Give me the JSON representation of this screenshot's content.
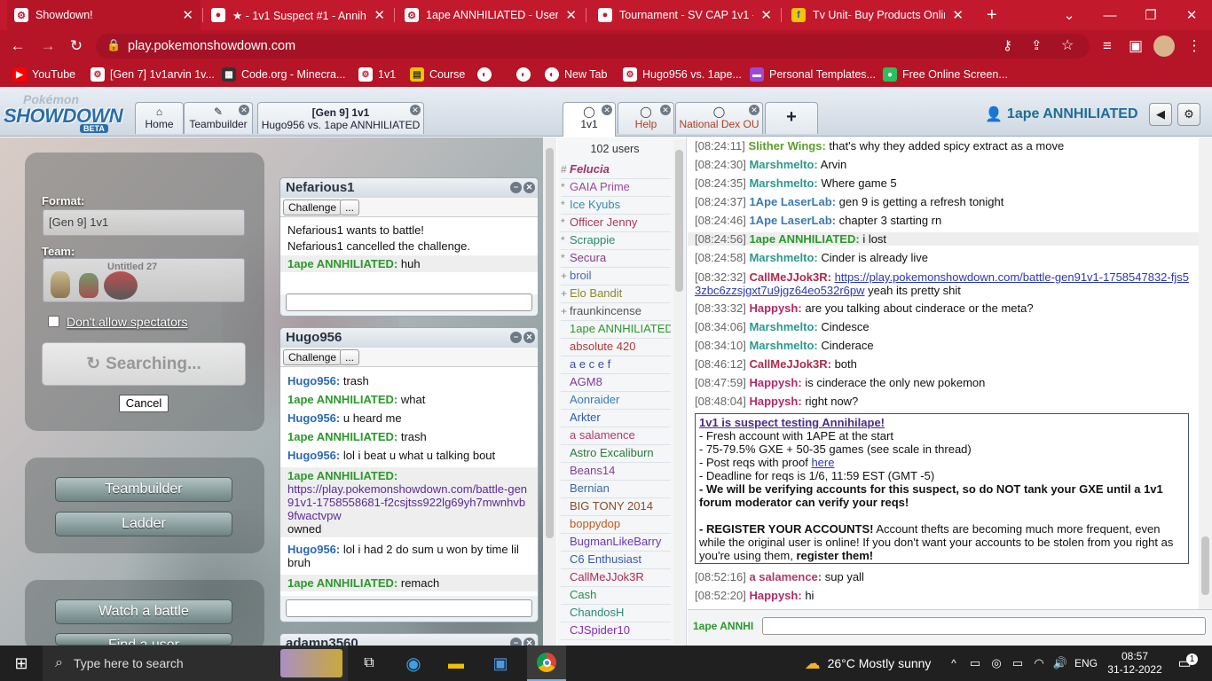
{
  "browser": {
    "tabs": [
      {
        "title": "Showdown!",
        "active": true
      },
      {
        "title": "★ - 1v1 Suspect #1 - Annihila"
      },
      {
        "title": "1ape ANNHILIATED - Users -"
      },
      {
        "title": "Tournament - SV CAP 1v1 - F"
      },
      {
        "title": "Tv Unit- Buy Products Online"
      }
    ],
    "new_tab": "+",
    "url": "play.pokemonshowdown.com",
    "bookmarks": [
      "YouTube",
      "[Gen 7] 1v1arvin 1v...",
      "Code.org - Minecra...",
      "1v1",
      "Course",
      "",
      "",
      "New Tab",
      "Hugo956 vs. 1ape...",
      "Personal Templates...",
      "Free Online Screen..."
    ]
  },
  "showdown": {
    "logo_top": "Pokémon",
    "logo_main": "SHOWDOWN",
    "logo_beta": "BETA",
    "tabs": {
      "home": "Home",
      "teambuilder": "Teambuilder",
      "battle_line1": "[Gen 9] 1v1",
      "battle_line2": "Hugo956 vs. 1ape ANNHILIATED",
      "room1": "1v1",
      "help": "Help",
      "ndou": "National Dex OU",
      "add": "+"
    },
    "username": "1ape ANNHILIATED"
  },
  "mainmenu": {
    "format_label": "Format:",
    "format_value": "[Gen 9] 1v1",
    "team_label": "Team:",
    "team_name": "Untitled 27",
    "spectators": "Don't allow spectators",
    "searching": "Searching...",
    "cancel": "Cancel",
    "teambuilder": "Teambuilder",
    "ladder": "Ladder",
    "watch": "Watch a battle",
    "find_user": "Find a user"
  },
  "pm1": {
    "name": "Nefarious1",
    "challenge": "Challenge",
    "more": "...",
    "lines": [
      {
        "text": "Nefarious1 wants to battle!"
      },
      {
        "text": "Nefarious1 cancelled the challenge."
      }
    ],
    "msg_user": "1ape ANNHILIATED:",
    "msg_text": "huh"
  },
  "pm2": {
    "name": "Hugo956",
    "challenge": "Challenge",
    "more": "...",
    "messages": [
      {
        "user": "Hugo956:",
        "text": "trash"
      },
      {
        "user": "1ape ANNHILIATED:",
        "text": "what"
      },
      {
        "user": "Hugo956:",
        "text": "u heard me"
      },
      {
        "user": "1ape ANNHILIATED:",
        "text": "trash"
      },
      {
        "user": "Hugo956:",
        "text": "lol i beat u what u talking bout"
      }
    ],
    "link_user": "1ape ANNHILIATED:",
    "link": "https://play.pokemonshowdown.com/battle-gen91v1-1758558681-f2csjtss922lg69yh7mwnhvb9fwactvpw",
    "link_after": "owned",
    "msg6_user": "Hugo956:",
    "msg6_text": "lol i had 2 do sum u won by time lil bruh",
    "msg7_user": "1ape ANNHILIATED:",
    "msg7_text": "remach"
  },
  "pm3": {
    "name": "adamn3560"
  },
  "userlist": {
    "count": "102 users",
    "users": [
      {
        "rank": "#",
        "name": "Felucia",
        "color": "#a0306a"
      },
      {
        "rank": "*",
        "name": "GAIA Prime",
        "color": "#9a4a9a"
      },
      {
        "rank": "*",
        "name": "Ice Kyubs",
        "color": "#3a8ab0"
      },
      {
        "rank": "*",
        "name": "Officer Jenny",
        "color": "#a83a5a"
      },
      {
        "rank": "*",
        "name": "Scrappie",
        "color": "#2a8a6a"
      },
      {
        "rank": "*",
        "name": "Secura",
        "color": "#8a3a8a"
      },
      {
        "rank": "+",
        "name": "broil",
        "color": "#4a6ab0"
      },
      {
        "rank": "+",
        "name": "Elo Bandit",
        "color": "#8a8a2a"
      },
      {
        "rank": "+",
        "name": "fraunkincense",
        "color": "#555555"
      },
      {
        "rank": "",
        "name": "1ape ANNHILIATED",
        "color": "#2a9a2a"
      },
      {
        "rank": "",
        "name": "absolute 420",
        "color": "#b03a3a"
      },
      {
        "rank": "",
        "name": "a e c e f",
        "color": "#3a4ab0"
      },
      {
        "rank": "",
        "name": "AGM8",
        "color": "#7a3a9a"
      },
      {
        "rank": "",
        "name": "Aonraider",
        "color": "#3a7ab0"
      },
      {
        "rank": "",
        "name": "Arkter",
        "color": "#2a5ab0"
      },
      {
        "rank": "",
        "name": "a salamence",
        "color": "#b03a6a"
      },
      {
        "rank": "",
        "name": "Astro Excaliburn",
        "color": "#2a7a3a"
      },
      {
        "rank": "",
        "name": "Beans14",
        "color": "#8a3aa0"
      },
      {
        "rank": "",
        "name": "Bernian",
        "color": "#3a6aa0"
      },
      {
        "rank": "",
        "name": "BIG TONY 2014",
        "color": "#8a4a2a"
      },
      {
        "rank": "",
        "name": "boppydop",
        "color": "#c05a1a"
      },
      {
        "rank": "",
        "name": "BugmanLikeBarry",
        "color": "#6a3ab0"
      },
      {
        "rank": "",
        "name": "C6 Enthusiast",
        "color": "#3a5ab0"
      },
      {
        "rank": "",
        "name": "CallMeJJok3R",
        "color": "#b02a4a"
      },
      {
        "rank": "",
        "name": "Cash",
        "color": "#2a8a4a"
      },
      {
        "rank": "",
        "name": "ChandosH",
        "color": "#2a8a7a"
      },
      {
        "rank": "",
        "name": "CJSpider10",
        "color": "#8a2ab0"
      }
    ]
  },
  "chat": {
    "lines": [
      {
        "ts": "[08:24:11]",
        "user": "Slither Wings:",
        "color": "#5aa02a",
        "text": "that's why they added spicy extract as a move"
      },
      {
        "ts": "[08:24:30]",
        "user": "Marshmelto:",
        "color": "#2a9a8a",
        "text": "Arvin"
      },
      {
        "ts": "[08:24:35]",
        "user": "Marshmelto:",
        "color": "#2a9a8a",
        "text": "Where game 5"
      },
      {
        "ts": "[08:24:37]",
        "user": "1Ape LaserLab:",
        "color": "#3a7ab0",
        "text": "gen 9 is getting a refresh tonight"
      },
      {
        "ts": "[08:24:46]",
        "user": "1Ape LaserLab:",
        "color": "#3a7ab0",
        "text": "chapter 3 starting rn"
      },
      {
        "ts": "[08:24:56]",
        "user": "1ape ANNHILIATED:",
        "color": "#2a9a2a",
        "text": "i lost"
      },
      {
        "ts": "[08:24:58]",
        "user": "Marshmelto:",
        "color": "#2a9a8a",
        "text": "Cinder is already live"
      }
    ],
    "link_ts": "[08:32:32]",
    "link_user": "CallMeJJok3R:",
    "link_url": "https://play.pokemonshowdown.com/battle-gen91v1-1758547832-fjs53zbc6zzsjgxt7u9jgz64eo532r6pw",
    "link_after": "yeah its pretty shit",
    "lines2": [
      {
        "ts": "[08:33:32]",
        "user": "Happysh:",
        "color": "#b02a6a",
        "text": "are you talking about cinderace or the meta?"
      },
      {
        "ts": "[08:34:06]",
        "user": "Marshmelto:",
        "color": "#2a9a8a",
        "text": "Cindesce"
      },
      {
        "ts": "[08:34:10]",
        "user": "Marshmelto:",
        "color": "#2a9a8a",
        "text": "Cinderace"
      },
      {
        "ts": "[08:46:12]",
        "user": "CallMeJJok3R:",
        "color": "#b02a4a",
        "text": "both"
      },
      {
        "ts": "[08:47:59]",
        "user": "Happysh:",
        "color": "#b02a6a",
        "text": "is cinderace the only new pokemon"
      },
      {
        "ts": "[08:48:04]",
        "user": "Happysh:",
        "color": "#b02a6a",
        "text": "right now?"
      }
    ],
    "announcement": {
      "title": "1v1 is suspect testing Annihilape!",
      "b1": "- Fresh account with 1APE at the start",
      "b2": "- 75-79.5% GXE + 50-35 games (see scale in thread)",
      "b3_pre": "- Post reqs with proof ",
      "b3_link": "here",
      "b4": "- Deadline for reqs is 1/6, 11:59 EST (GMT -5)",
      "b5": "- We will be verifying accounts for this suspect, so do NOT tank your GXE until a 1v1 forum moderator can verify your reqs!",
      "b6_bold": "- REGISTER YOUR ACCOUNTS!",
      "b6_text": " Account thefts are becoming much more frequent, even while the original user is online! If you don't want your accounts to be stolen from you right as you're using them, ",
      "b6_end": "register them!"
    },
    "lines3": [
      {
        "ts": "[08:52:16]",
        "user": "a salamence:",
        "color": "#b03a6a",
        "text": "sup yall"
      },
      {
        "ts": "[08:52:20]",
        "user": "Happysh:",
        "color": "#b02a6a",
        "text": "hi"
      }
    ],
    "input_user": "1ape ANNHI"
  },
  "taskbar": {
    "search": "Type here to search",
    "weather": "26°C  Mostly sunny",
    "lang": "ENG",
    "time": "08:57",
    "date": "31-12-2022",
    "notif": "1"
  }
}
